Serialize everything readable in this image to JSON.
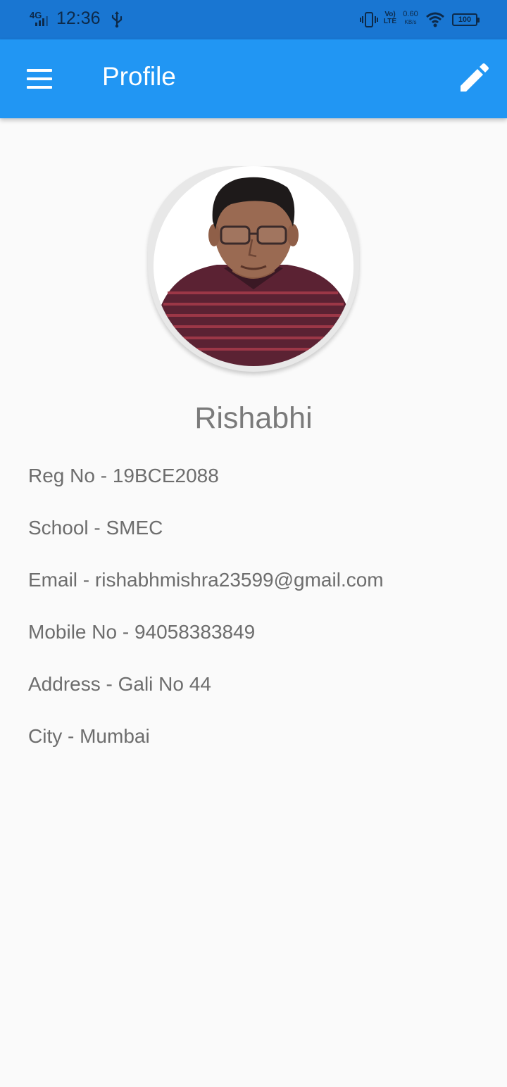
{
  "status_bar": {
    "network": "4G",
    "time": "12:36",
    "volte": "Vo) LTE",
    "speed_value": "0.60",
    "speed_unit": "KB/s",
    "battery": "100"
  },
  "app_bar": {
    "title": "Profile",
    "menu_icon": "menu-icon",
    "edit_icon": "edit-pencil-icon",
    "color": "#2196f3"
  },
  "profile": {
    "name": "Rishabhi",
    "fields": [
      {
        "label": "Reg No",
        "value": "19BCE2088",
        "text": "Reg No - 19BCE2088"
      },
      {
        "label": "School",
        "value": "SMEC",
        "text": "School - SMEC"
      },
      {
        "label": "Email",
        "value": "rishabhmishra23599@gmail.com",
        "text": "Email - rishabhmishra23599@gmail.com"
      },
      {
        "label": "Mobile No",
        "value": "94058383849",
        "text": "Mobile No - 94058383849"
      },
      {
        "label": "Address",
        "value": "Gali No 44",
        "text": "Address - Gali No 44"
      },
      {
        "label": "City",
        "value": "Mumbai",
        "text": "City - Mumbai"
      }
    ]
  }
}
